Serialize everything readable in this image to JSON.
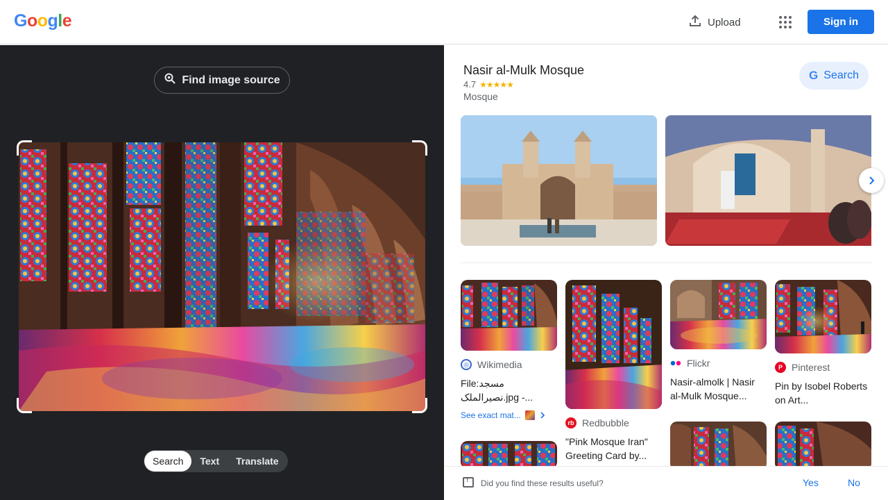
{
  "header": {
    "logo_letters": [
      "G",
      "o",
      "o",
      "g",
      "l",
      "e"
    ],
    "logo_colors": [
      "#4285f4",
      "#ea4335",
      "#fbbc05",
      "#4285f4",
      "#34a853",
      "#ea4335"
    ],
    "upload_label": "Upload",
    "signin_label": "Sign in"
  },
  "left": {
    "find_source_label": "Find image source",
    "tabs": [
      {
        "label": "Search",
        "active": true
      },
      {
        "label": "Text",
        "active": false
      },
      {
        "label": "Translate",
        "active": false
      }
    ]
  },
  "knowledge_panel": {
    "title": "Nasir al-Mulk Mosque",
    "rating": "4.7",
    "stars": "★★★★★",
    "type": "Mosque",
    "search_label": "Search",
    "search_letter": "G"
  },
  "results": [
    {
      "source": "Wikimedia",
      "title": "File:مسجد نصیرالملک.jpg -...",
      "exact_match": "See exact mat..."
    },
    {
      "source": "Redbubble",
      "title": "\"Pink Mosque Iran\" Greeting Card by..."
    },
    {
      "source": "Flickr",
      "title": "Nasir-almolk | Nasir al-Mulk Mosque..."
    },
    {
      "source": "Pinterest",
      "title": "Pin by Isobel Roberts on Art..."
    }
  ],
  "feedback": {
    "question": "Did you find these results useful?",
    "yes": "Yes",
    "no": "No"
  },
  "colors": {
    "accent": "#1a73e8",
    "dark_panel": "#202124",
    "star": "#f4b400"
  }
}
